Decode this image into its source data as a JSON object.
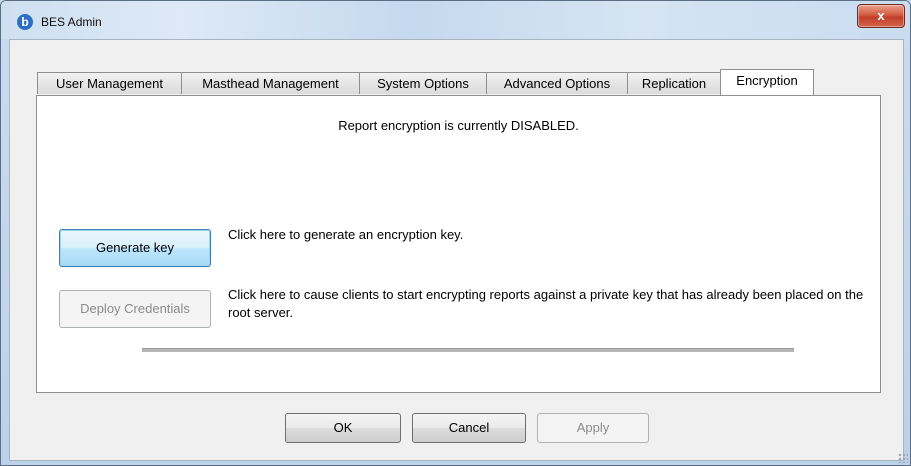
{
  "window": {
    "title": "BES Admin",
    "app_icon": "bigfix-b-icon",
    "close_label": "x"
  },
  "tabs": [
    {
      "label": "User Management",
      "active": false
    },
    {
      "label": "Masthead Management",
      "active": false
    },
    {
      "label": "System Options",
      "active": false
    },
    {
      "label": "Advanced Options",
      "active": false
    },
    {
      "label": "Replication",
      "active": false
    },
    {
      "label": "Encryption",
      "active": true
    }
  ],
  "encryption": {
    "status_text": "Report encryption is currently DISABLED.",
    "generate_label": "Generate key",
    "generate_desc": "Click here to generate an encryption key.",
    "deploy_label": "Deploy Credentials",
    "deploy_desc": "Click here to cause clients to start encrypting reports against a private key that has already been placed on the root server.",
    "progress": 0
  },
  "footer": {
    "ok_label": "OK",
    "cancel_label": "Cancel",
    "apply_label": "Apply"
  },
  "colors": {
    "close_button": "#c0402a",
    "focus_border": "#3c7fb1",
    "disabled_text": "#8b8b8b"
  }
}
